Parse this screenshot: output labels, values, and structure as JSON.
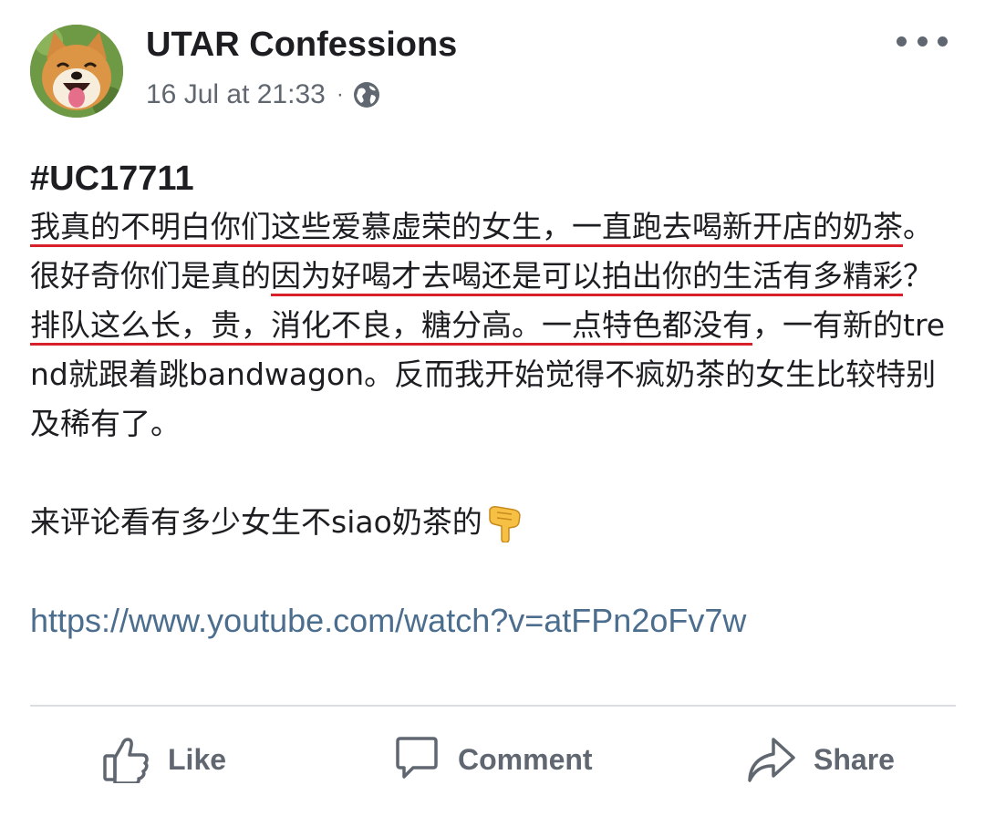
{
  "post": {
    "page_name": "UTAR Confessions",
    "timestamp": "16 Jul at 21:33",
    "separator": "·",
    "audience_icon": "globe-icon",
    "more_icon": "more-options-icon",
    "hashtag": "#UC17711",
    "body": {
      "s1": "我真的不明白你们这些爱慕虚荣的女生，一直跑去喝新开店的奶茶",
      "s2": "。很好奇你们是真的",
      "s3": "因为好喝才去喝还是可以拍出你的生活有多精彩",
      "s4": "？",
      "s5": "排队这么长，贵，消化不良，糖分高。一点特色都没有",
      "s6": "，一有新的trend就跟着跳bandwagon。反而我开始觉得不疯奶茶的女生比较特别及稀有了。"
    },
    "cta": "来评论看有多少女生不siao奶茶的",
    "cta_emoji": "backhand-index-pointing-down-icon",
    "link": "https://www.youtube.com/watch?v=atFPn2oFv7w"
  },
  "actions": {
    "like": "Like",
    "comment": "Comment",
    "share": "Share"
  },
  "colors": {
    "text": "#1c1e21",
    "secondary": "#606770",
    "link": "#4b6d8e",
    "underline": "#d8202a",
    "divider": "#dadde1"
  }
}
